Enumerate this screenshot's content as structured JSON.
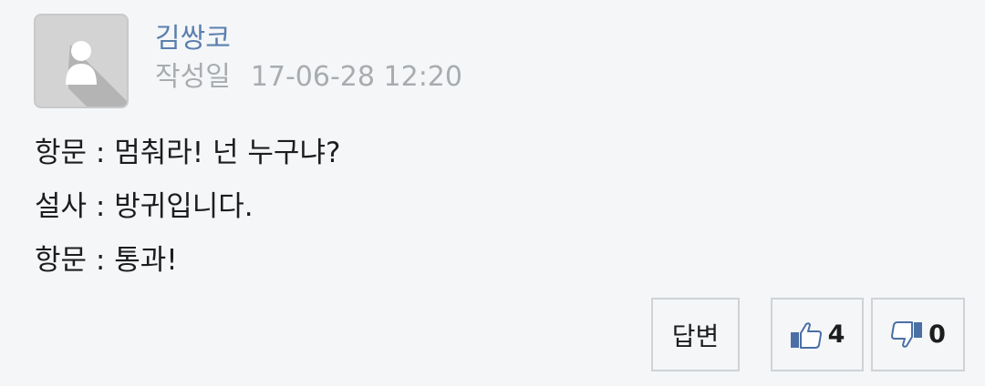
{
  "comment": {
    "author": "김쌍코",
    "date_label": "작성일",
    "date": "17-06-28 12:20",
    "lines": [
      "항문 : 멈춰라! 넌 누구냐?",
      "설사 : 방귀입니다.",
      "항문 : 통과!"
    ]
  },
  "actions": {
    "reply_label": "답변",
    "like_count": "4",
    "dislike_count": "0"
  },
  "icons": {
    "avatar": "default-user-avatar-icon",
    "like": "thumbs-up-icon",
    "dislike": "thumbs-down-icon"
  },
  "colors": {
    "author": "#5b7fae",
    "meta": "#a9acaf",
    "text": "#1d1d1d",
    "background": "#f4f6f8",
    "icon_blue": "#4a6fa5"
  }
}
